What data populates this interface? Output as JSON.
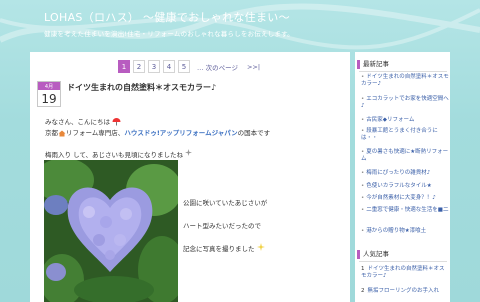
{
  "header": {
    "title": "LOHAS（ロハス） 〜健康でおしゃれな住まい〜",
    "subtitle": "健康を考えた住まいを演出!住宅・リフォームのおしゃれな暮らしをお伝えします。"
  },
  "pager": {
    "pages": [
      "1",
      "2",
      "3",
      "4",
      "5"
    ],
    "active": "1",
    "next_label": "次のページ",
    "last_label": ">>|"
  },
  "post": {
    "month": "4月",
    "day": "19",
    "title": "ドイツ生まれの自然塗料＊オスモカラー♪",
    "lines": {
      "greeting": "みなさん、こんにちは",
      "intro_pre": "京都",
      "intro_mid": "リフォーム専門店、",
      "intro_brand": "ハウスドゥ!アップリフォームジャパン",
      "intro_post": "の国本です",
      "weather": "梅雨入り  して、あじさいも見頃になりましたね"
    },
    "captions": [
      "公園に咲いていたあじさいが",
      "ハート型みたいだったので",
      "記念に写真を撮りました"
    ]
  },
  "sidebar": {
    "recent_title": "最新記事",
    "recent_items": [
      "ドイツ生まれの自然塗料＊オスモカラー♪",
      "エコカラットでお家を快適空間へ♪",
      "古民家◆リフォーム",
      "段暴工館とうまく付き合うには・・",
      "夏の暑さも快適に★断熱リフォーム",
      "梅雨にぴったりの雑貨材♪",
      "色使いカラフルなタイル★",
      "今が自然素材に大変身？！♪",
      "二重窓で健康・快適な生活を■二",
      "港からの贈り物★漆喰土"
    ],
    "popular_title": "人気記事",
    "popular_items": [
      {
        "rank": "1",
        "text": "ドイツ生まれの自然塗料＊オスモカラー♪"
      },
      {
        "rank": "2",
        "text": "無垢フローリングのお手入れ"
      }
    ]
  }
}
